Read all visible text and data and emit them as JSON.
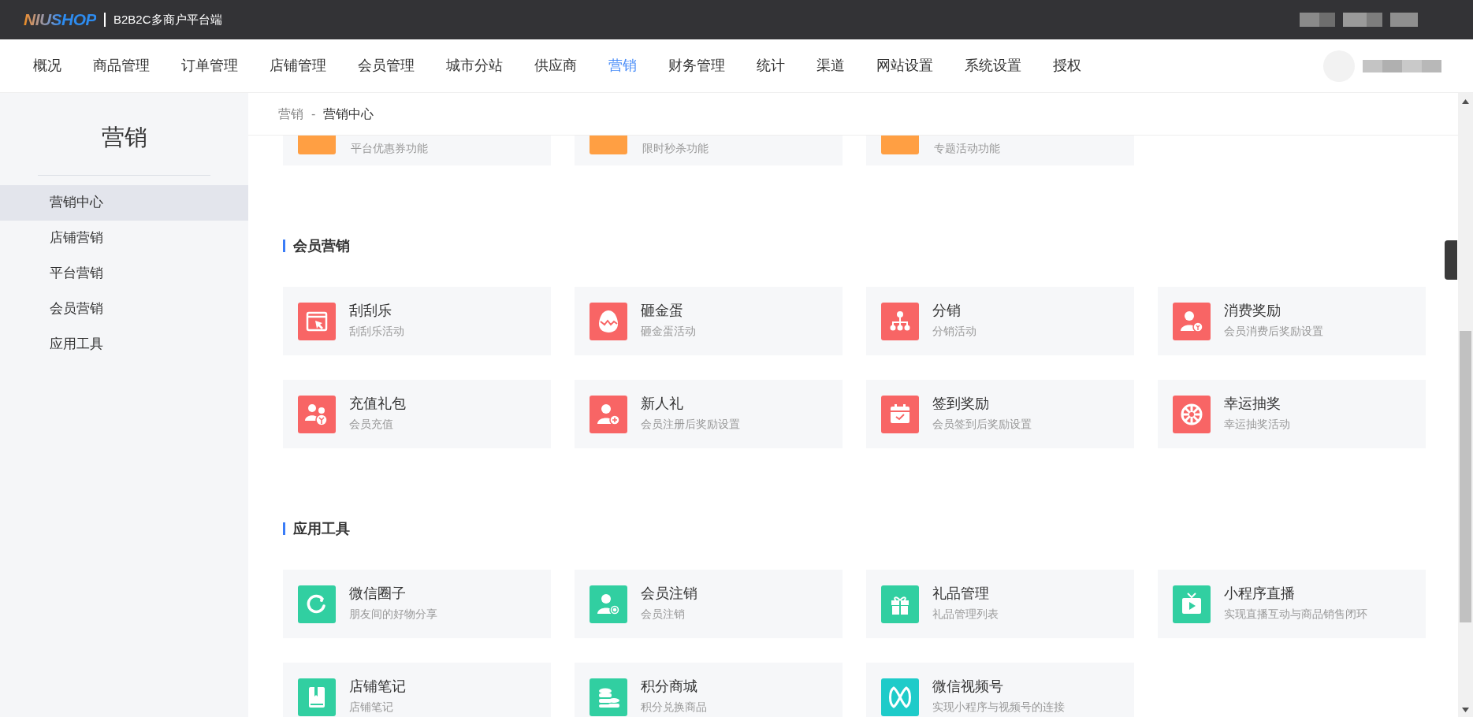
{
  "header": {
    "logo": "NIUSHOP",
    "subtitle": "B2B2C多商户平台端"
  },
  "nav": [
    {
      "label": "概况",
      "selected": false
    },
    {
      "label": "商品管理",
      "selected": false
    },
    {
      "label": "订单管理",
      "selected": false
    },
    {
      "label": "店铺管理",
      "selected": false
    },
    {
      "label": "会员管理",
      "selected": false
    },
    {
      "label": "城市分站",
      "selected": false
    },
    {
      "label": "供应商",
      "selected": false
    },
    {
      "label": "营销",
      "selected": true
    },
    {
      "label": "财务管理",
      "selected": false
    },
    {
      "label": "统计",
      "selected": false
    },
    {
      "label": "渠道",
      "selected": false
    },
    {
      "label": "网站设置",
      "selected": false
    },
    {
      "label": "系统设置",
      "selected": false
    },
    {
      "label": "授权",
      "selected": false
    }
  ],
  "sidebar": {
    "title": "营销",
    "items": [
      {
        "label": "营销中心",
        "selected": true
      },
      {
        "label": "店铺营销",
        "selected": false
      },
      {
        "label": "平台营销",
        "selected": false
      },
      {
        "label": "会员营销",
        "selected": false
      },
      {
        "label": "应用工具",
        "selected": false
      }
    ]
  },
  "breadcrumb": [
    "营销",
    "-",
    "营销中心"
  ],
  "partial_cards": [
    {
      "description": "平台优惠券功能",
      "color": "#ff9f43"
    },
    {
      "description": "限时秒杀功能",
      "color": "#ff9f43"
    },
    {
      "description": "专题活动功能",
      "color": "#ff9f43"
    }
  ],
  "sections": [
    {
      "title": "会员营销",
      "cards": [
        {
          "title": "刮刮乐",
          "description": "刮刮乐活动",
          "color": "#f86565"
        },
        {
          "title": "砸金蛋",
          "description": "砸金蛋活动",
          "color": "#f86565"
        },
        {
          "title": "分销",
          "description": "分销活动",
          "color": "#f86565"
        },
        {
          "title": "消费奖励",
          "description": "会员消费后奖励设置",
          "color": "#f86565"
        },
        {
          "title": "充值礼包",
          "description": "会员充值",
          "color": "#f86565"
        },
        {
          "title": "新人礼",
          "description": "会员注册后奖励设置",
          "color": "#f86565"
        },
        {
          "title": "签到奖励",
          "description": "会员签到后奖励设置",
          "color": "#f86565"
        },
        {
          "title": "幸运抽奖",
          "description": "幸运抽奖活动",
          "color": "#f86565"
        }
      ]
    },
    {
      "title": "应用工具",
      "cards": [
        {
          "title": "微信圈子",
          "description": "朋友间的好物分享",
          "color": "#31cfa1"
        },
        {
          "title": "会员注销",
          "description": "会员注销",
          "color": "#31cfa1"
        },
        {
          "title": "礼品管理",
          "description": "礼品管理列表",
          "color": "#31cfa1"
        },
        {
          "title": "小程序直播",
          "description": "实现直播互动与商品销售闭环",
          "color": "#31cfa1"
        },
        {
          "title": "店铺笔记",
          "description": "店铺笔记",
          "color": "#31cfa1"
        },
        {
          "title": "积分商城",
          "description": "积分兑换商品",
          "color": "#31cfa1"
        },
        {
          "title": "微信视频号",
          "description": "实现小程序与视频号的连接",
          "color": "#1ecbc9"
        }
      ]
    }
  ]
}
